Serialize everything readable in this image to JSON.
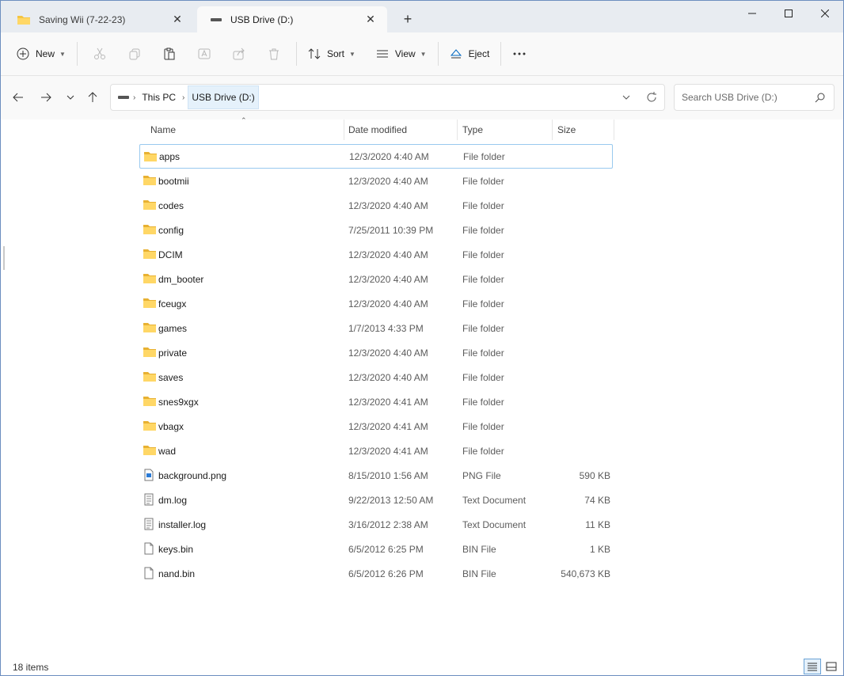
{
  "tabs": [
    {
      "label": "Saving Wii (7-22-23)",
      "icon": "folder-icon",
      "active": false
    },
    {
      "label": "USB Drive (D:)",
      "icon": "drive-icon",
      "active": true
    }
  ],
  "commands": {
    "new_label": "New",
    "sort_label": "Sort",
    "view_label": "View",
    "eject_label": "Eject"
  },
  "address": {
    "crumbs": [
      "This PC",
      "USB Drive (D:)"
    ]
  },
  "search": {
    "placeholder": "Search USB Drive (D:)"
  },
  "columns": {
    "name": "Name",
    "date": "Date modified",
    "type": "Type",
    "size": "Size"
  },
  "files": [
    {
      "name": "apps",
      "date": "12/3/2020 4:40 AM",
      "type": "File folder",
      "size": "",
      "kind": "folder"
    },
    {
      "name": "bootmii",
      "date": "12/3/2020 4:40 AM",
      "type": "File folder",
      "size": "",
      "kind": "folder"
    },
    {
      "name": "codes",
      "date": "12/3/2020 4:40 AM",
      "type": "File folder",
      "size": "",
      "kind": "folder"
    },
    {
      "name": "config",
      "date": "7/25/2011 10:39 PM",
      "type": "File folder",
      "size": "",
      "kind": "folder"
    },
    {
      "name": "DCIM",
      "date": "12/3/2020 4:40 AM",
      "type": "File folder",
      "size": "",
      "kind": "folder"
    },
    {
      "name": "dm_booter",
      "date": "12/3/2020 4:40 AM",
      "type": "File folder",
      "size": "",
      "kind": "folder"
    },
    {
      "name": "fceugx",
      "date": "12/3/2020 4:40 AM",
      "type": "File folder",
      "size": "",
      "kind": "folder"
    },
    {
      "name": "games",
      "date": "1/7/2013 4:33 PM",
      "type": "File folder",
      "size": "",
      "kind": "folder"
    },
    {
      "name": "private",
      "date": "12/3/2020 4:40 AM",
      "type": "File folder",
      "size": "",
      "kind": "folder"
    },
    {
      "name": "saves",
      "date": "12/3/2020 4:40 AM",
      "type": "File folder",
      "size": "",
      "kind": "folder"
    },
    {
      "name": "snes9xgx",
      "date": "12/3/2020 4:41 AM",
      "type": "File folder",
      "size": "",
      "kind": "folder"
    },
    {
      "name": "vbagx",
      "date": "12/3/2020 4:41 AM",
      "type": "File folder",
      "size": "",
      "kind": "folder"
    },
    {
      "name": "wad",
      "date": "12/3/2020 4:41 AM",
      "type": "File folder",
      "size": "",
      "kind": "folder"
    },
    {
      "name": "background.png",
      "date": "8/15/2010 1:56 AM",
      "type": "PNG File",
      "size": "590 KB",
      "kind": "image"
    },
    {
      "name": "dm.log",
      "date": "9/22/2013 12:50 AM",
      "type": "Text Document",
      "size": "74 KB",
      "kind": "text"
    },
    {
      "name": "installer.log",
      "date": "3/16/2012 2:38 AM",
      "type": "Text Document",
      "size": "11 KB",
      "kind": "text"
    },
    {
      "name": "keys.bin",
      "date": "6/5/2012 6:25 PM",
      "type": "BIN File",
      "size": "1 KB",
      "kind": "file"
    },
    {
      "name": "nand.bin",
      "date": "6/5/2012 6:26 PM",
      "type": "BIN File",
      "size": "540,673 KB",
      "kind": "file"
    }
  ],
  "status": {
    "item_count": "18 items"
  },
  "colors": {
    "folder": "#f4c542",
    "accent": "#0067c0"
  }
}
